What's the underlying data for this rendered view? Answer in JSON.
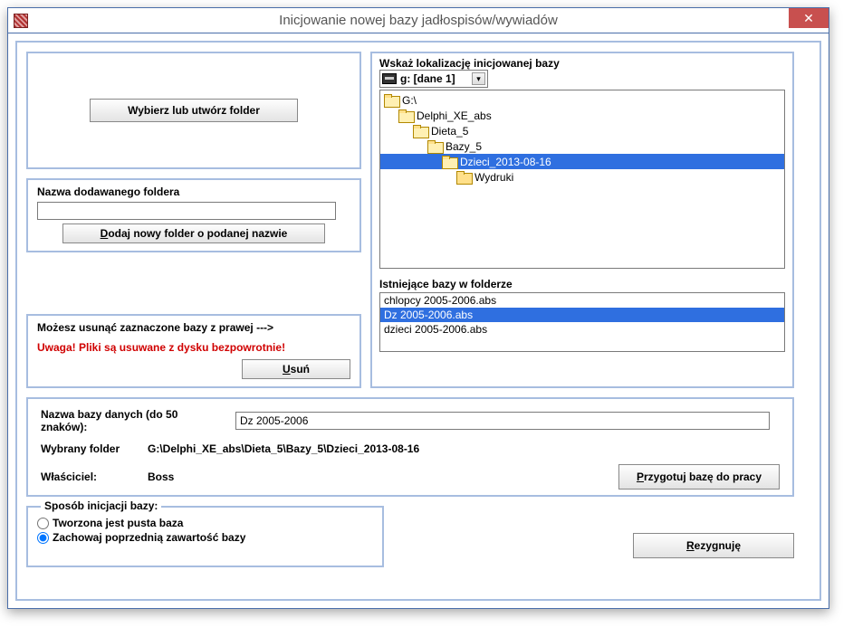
{
  "window": {
    "title": "Inicjowanie nowej bazy jadłospisów/wywiadów"
  },
  "choose": {
    "button": "Wybierz lub utwórz  folder"
  },
  "newfolder": {
    "label": "Nazwa dodawanego foldera",
    "value": "",
    "button": "Dodaj nowy folder o podanej nazwie",
    "button_accel": "D"
  },
  "delete": {
    "hint": "Możesz usunąć zaznaczone bazy z prawej --->",
    "warning": "Uwaga! Pliki są usuwane z dysku bezpowrotnie!",
    "button": "Usuń",
    "button_accel": "U"
  },
  "location": {
    "label": "Wskaż lokalizację inicjowanej bazy",
    "drive": "g: [dane 1]",
    "tree": [
      {
        "name": "G:\\",
        "indent": 0,
        "open": true
      },
      {
        "name": "Delphi_XE_abs",
        "indent": 1,
        "open": true
      },
      {
        "name": "Dieta_5",
        "indent": 2,
        "open": true
      },
      {
        "name": "Bazy_5",
        "indent": 3,
        "open": true
      },
      {
        "name": "Dzieci_2013-08-16",
        "indent": 4,
        "open": true,
        "selected": true
      },
      {
        "name": "Wydruki",
        "indent": 5,
        "open": false
      }
    ],
    "existing_label": "Istniejące bazy w folderze",
    "files": [
      {
        "name": "chlopcy 2005-2006.abs"
      },
      {
        "name": "Dz 2005-2006.abs",
        "selected": true
      },
      {
        "name": "dzieci 2005-2006.abs"
      }
    ]
  },
  "db": {
    "name_label": "Nazwa bazy danych (do 50 znaków):",
    "name_value": "Dz 2005-2006",
    "folder_label": "Wybrany folder",
    "folder_value": "G:\\Delphi_XE_abs\\Dieta_5\\Bazy_5\\Dzieci_2013-08-16",
    "owner_label": "Właściciel:",
    "owner_value": "Boss",
    "prepare_button": "Przygotuj bazę do pracy",
    "prepare_accel": "P"
  },
  "init": {
    "legend": "Sposób inicjacji bazy:",
    "opt_empty": "Tworzona jest pusta baza",
    "opt_keep": "Zachowaj poprzednią zawartość bazy",
    "selected": "keep"
  },
  "cancel": {
    "label": "Rezygnuję",
    "accel": "R"
  }
}
